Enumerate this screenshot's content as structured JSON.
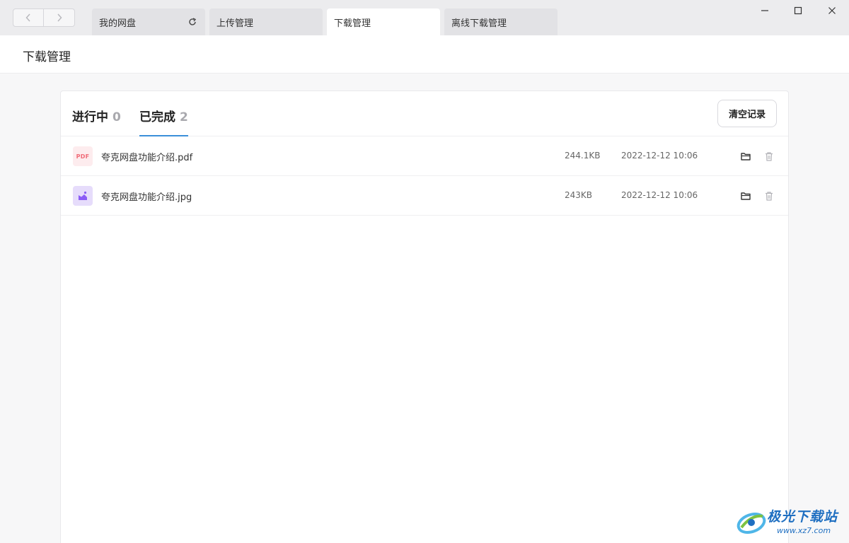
{
  "nav": {
    "back_icon": "chevron-left-icon",
    "forward_icon": "chevron-right-icon"
  },
  "tabs": [
    {
      "label": "我的网盘",
      "has_refresh": true
    },
    {
      "label": "上传管理"
    },
    {
      "label": "下载管理",
      "active": true
    },
    {
      "label": "离线下载管理"
    }
  ],
  "window_controls": {
    "minimize_icon": "minimize-icon",
    "maximize_icon": "maximize-icon",
    "close_icon": "close-icon"
  },
  "page": {
    "title": "下载管理"
  },
  "panel": {
    "tabs": [
      {
        "label": "进行中",
        "count": "0",
        "active": false
      },
      {
        "label": "已完成",
        "count": "2",
        "active": true
      }
    ],
    "clear_label": "清空记录",
    "files": [
      {
        "icon": "pdf-file-icon",
        "icon_text": "PDF",
        "name": "夸克网盘功能介绍.pdf",
        "size": "244.1KB",
        "time": "2022-12-12 10:06"
      },
      {
        "icon": "image-file-icon",
        "name": "夸克网盘功能介绍.jpg",
        "size": "243KB",
        "time": "2022-12-12 10:06"
      }
    ]
  },
  "watermark": {
    "title": "极光下载站",
    "url": "www.xz7.com"
  },
  "colors": {
    "accent": "#3b8fd9",
    "pdf": "#f06b78",
    "image": "#8b5cf6"
  }
}
